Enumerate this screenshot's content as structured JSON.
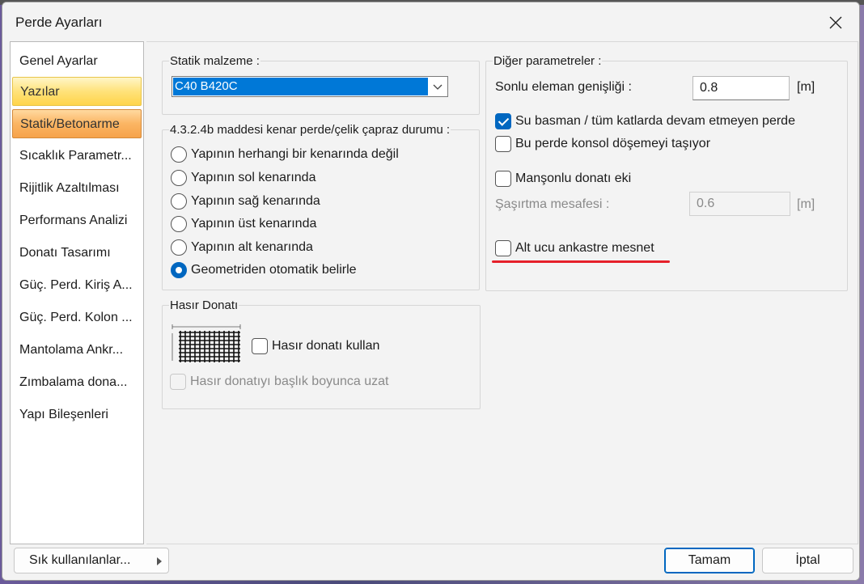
{
  "window": {
    "title": "Perde Ayarları"
  },
  "sidebar": {
    "items": [
      {
        "label": "Genel Ayarlar"
      },
      {
        "label": "Yazılar"
      },
      {
        "label": "Statik/Betonarme"
      },
      {
        "label": "Sıcaklık Parametr..."
      },
      {
        "label": "Rijitlik Azaltılması"
      },
      {
        "label": "Performans Analizi"
      },
      {
        "label": "Donatı Tasarımı"
      },
      {
        "label": "Güç. Perd. Kiriş A..."
      },
      {
        "label": "Güç. Perd. Kolon ..."
      },
      {
        "label": "Mantolama Ankr..."
      },
      {
        "label": "Zımbalama dona..."
      },
      {
        "label": "Yapı Bileşenleri"
      }
    ]
  },
  "static_material": {
    "title": "Statik malzeme :",
    "value": "C40 B420C"
  },
  "edge_group": {
    "title": "4.3.2.4b maddesi kenar perde/çelik çapraz durumu :",
    "options": [
      {
        "label": "Yapının herhangi bir kenarında değil",
        "selected": false
      },
      {
        "label": "Yapının sol kenarında",
        "selected": false
      },
      {
        "label": "Yapının sağ kenarında",
        "selected": false
      },
      {
        "label": "Yapının üst kenarında",
        "selected": false
      },
      {
        "label": "Yapının alt kenarında",
        "selected": false
      },
      {
        "label": "Geometriden otomatik belirle",
        "selected": true
      }
    ]
  },
  "mesh": {
    "title": "Hasır Donatı",
    "use_label": "Hasır donatı kullan",
    "use_checked": false,
    "extend_label": "Hasır donatıyı başlık boyunca uzat",
    "extend_checked": false
  },
  "other": {
    "title": "Diğer parametreler :",
    "fe_width_label": "Sonlu eleman genişliği :",
    "fe_width_value": "0.8",
    "fe_width_unit": "[m]",
    "basement_label": "Su basman / tüm katlarda devam etmeyen perde",
    "basement_checked": true,
    "cantilever_label": "Bu perde konsol döşemeyi taşıyor",
    "cantilever_checked": false,
    "sleeve_label": "Manşonlu donatı eki",
    "sleeve_checked": false,
    "stagger_label": "Şaşırtma mesafesi :",
    "stagger_value": "0.6",
    "stagger_unit": "[m]",
    "fixed_label": "Alt ucu ankastre mesnet",
    "fixed_checked": false
  },
  "footer": {
    "favorites": "Sık kullanılanlar...",
    "ok": "Tamam",
    "cancel": "İptal"
  },
  "colors": {
    "accent": "#0067c0",
    "highlight_underline": "#e5202a"
  }
}
